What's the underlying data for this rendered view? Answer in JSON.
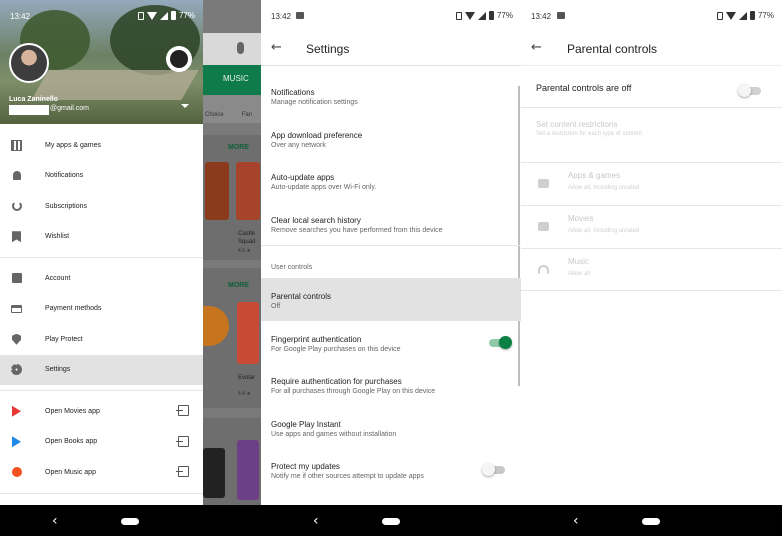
{
  "status": {
    "panel1_time": "13:42",
    "panel2_time": "13:42",
    "panel3_time": "13:42",
    "battery": "77%"
  },
  "drawer": {
    "account_name": "Luca Zaninello",
    "account_email_suffix": "@gmail.com",
    "items": [
      {
        "label": "My apps & games",
        "icon": "apps-grid-icon"
      },
      {
        "label": "Notifications",
        "icon": "bell-icon"
      },
      {
        "label": "Subscriptions",
        "icon": "sync-icon"
      },
      {
        "label": "Wishlist",
        "icon": "bookmark-check-icon"
      },
      {
        "label": "Account",
        "icon": "account-box-icon"
      },
      {
        "label": "Payment methods",
        "icon": "credit-card-icon"
      },
      {
        "label": "Play Protect",
        "icon": "shield-play-icon"
      },
      {
        "label": "Settings",
        "icon": "gear-icon",
        "active": true
      },
      {
        "label": "Open Movies app",
        "icon": "play-movies-icon",
        "color": "#e53935"
      },
      {
        "label": "Open Books app",
        "icon": "play-books-icon",
        "color": "#1e88e5"
      },
      {
        "label": "Open Music app",
        "icon": "play-music-icon",
        "color": "#f4511e"
      }
    ]
  },
  "background_app": {
    "tab_label": "MUSIC",
    "chip_1": "Choice",
    "chip_2": "Fan",
    "more_1": "MORE",
    "more_2": "MORE",
    "app_name_1": "Castle",
    "app_name_1b": "Squad",
    "rating_1": "4.5 ★",
    "app_name_2": "Evolar",
    "rating_2": "4.4 ★"
  },
  "settings": {
    "title": "Settings",
    "rows": [
      {
        "title": "Notifications",
        "subtitle": "Manage notification settings"
      },
      {
        "title": "App download preference",
        "subtitle": "Over any network"
      },
      {
        "title": "Auto-update apps",
        "subtitle": "Auto-update apps over Wi-Fi only."
      },
      {
        "title": "Clear local search history",
        "subtitle": "Remove searches you have performed from this device"
      }
    ],
    "section_label": "User controls",
    "user_rows": [
      {
        "title": "Parental controls",
        "subtitle": "Off"
      },
      {
        "title": "Fingerprint authentication",
        "subtitle": "For Google Play purchases on this device",
        "toggle": true
      },
      {
        "title": "Require authentication for purchases",
        "subtitle": "For all purchases through Google Play on this device"
      },
      {
        "title": "Google Play Instant",
        "subtitle": "Use apps and games without installation"
      },
      {
        "title": "Protect my updates",
        "subtitle": "Notify me if other sources attempt to update apps",
        "toggle": false
      }
    ],
    "toggle_on_color": "#0b8043"
  },
  "parental": {
    "title": "Parental controls",
    "master_label": "Parental controls are off",
    "master_toggle": false,
    "restrict_title": "Set content restrictions",
    "restrict_subtitle": "Set a restriction for each type of content",
    "categories": [
      {
        "title": "Apps & games",
        "subtitle": "Allow all, including unrated",
        "icon": "android-icon"
      },
      {
        "title": "Movies",
        "subtitle": "Allow all, including unrated",
        "icon": "movie-icon"
      },
      {
        "title": "Music",
        "subtitle": "Allow all",
        "icon": "headphones-icon"
      }
    ]
  },
  "nav": {
    "back_glyph": "‹"
  }
}
